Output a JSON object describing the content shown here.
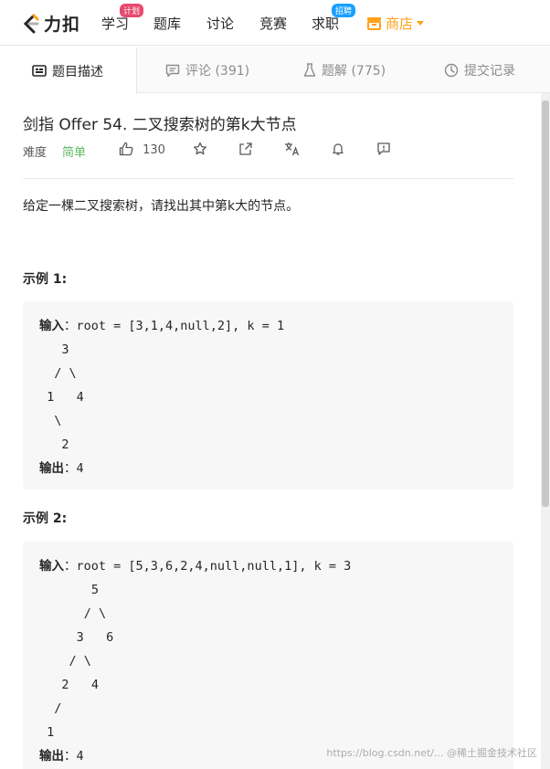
{
  "nav": {
    "logo_text": "力扣",
    "items": [
      {
        "label": "学习",
        "badge": "计划"
      },
      {
        "label": "题库"
      },
      {
        "label": "讨论"
      },
      {
        "label": "竞赛"
      },
      {
        "label": "求职",
        "badge": "招聘"
      }
    ],
    "shop_label": "商店",
    "accent": "#ffa116"
  },
  "tabs": [
    {
      "label": "题目描述",
      "icon": "description-icon",
      "active": true
    },
    {
      "label": "评论 (391)",
      "icon": "comment-icon"
    },
    {
      "label": "题解 (775)",
      "icon": "flask-icon"
    },
    {
      "label": "提交记录",
      "icon": "clock-icon"
    }
  ],
  "problem": {
    "title": "剑指 Offer 54. 二叉搜索树的第k大节点",
    "difficulty_label": "难度",
    "difficulty_value": "简单",
    "likes": "130",
    "description": "给定一棵二叉搜索树，请找出其中第k大的节点。",
    "examples": [
      {
        "title": "示例 1:",
        "input_label": "输入",
        "input_value": "：root = [3,1,4,null,2], k = 1",
        "tree": "   3\n  / \\\n 1   4\n  \\\n   2",
        "output_label": "输出",
        "output_value": "：4"
      },
      {
        "title": "示例 2:",
        "input_label": "输入",
        "input_value": "：root = [5,3,6,2,4,null,null,1], k = 3",
        "tree": "       5\n      / \\\n     3   6\n    / \\\n   2   4\n  /\n 1",
        "output_label": "输出",
        "output_value": "：4"
      }
    ]
  },
  "watermark": "https://blog.csdn.net/... @稀土掘金技术社区"
}
